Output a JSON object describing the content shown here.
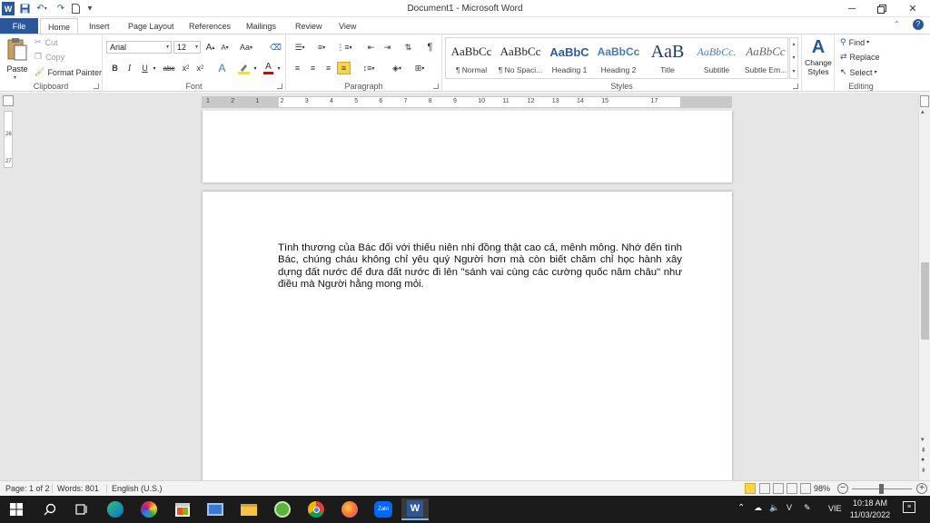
{
  "window": {
    "title": "Document1 - Microsoft Word"
  },
  "tabs": [
    "File",
    "Home",
    "Insert",
    "Page Layout",
    "References",
    "Mailings",
    "Review",
    "View"
  ],
  "clipboard": {
    "paste": "Paste",
    "cut": "Cut",
    "copy": "Copy",
    "format_painter": "Format Painter",
    "label": "Clipboard"
  },
  "font": {
    "name": "Arial",
    "size": "12",
    "label": "Font"
  },
  "paragraph": {
    "label": "Paragraph"
  },
  "styles": {
    "items": [
      {
        "preview": "AaBbCc",
        "name": "¶ Normal"
      },
      {
        "preview": "AaBbCc",
        "name": "¶ No Spaci..."
      },
      {
        "preview": "AaBbC",
        "name": "Heading 1"
      },
      {
        "preview": "AaBbCc",
        "name": "Heading 2"
      },
      {
        "preview": "AaB",
        "name": "Title"
      },
      {
        "preview": "AaBbCc.",
        "name": "Subtitle"
      },
      {
        "preview": "AaBbCc",
        "name": "Subtle Em..."
      }
    ],
    "change_styles": "Change Styles",
    "label": "Styles"
  },
  "editing": {
    "find": "Find",
    "replace": "Replace",
    "select": "Select",
    "label": "Editing"
  },
  "ruler": {
    "ticks": [
      "1",
      "2",
      "1",
      "2",
      "3",
      "4",
      "5",
      "6",
      "7",
      "8",
      "9",
      "10",
      "11",
      "12",
      "13",
      "14",
      "15",
      "",
      "17"
    ],
    "vticks": [
      "26",
      "27"
    ]
  },
  "document": {
    "text": "Tình thương của Bác đối với thiếu niên nhi đồng thật cao cả, mênh mông. Nhớ đến tình Bác, chúng cháu không chỉ yêu quý Người hơn mà còn biết chăm chỉ học hành xây dựng đất nước để đưa đất nước đi lên \"sánh vai cùng các cường quốc năm châu\" như điều mà Người hằng mong mỏi."
  },
  "status": {
    "page": "Page: 1 of 2",
    "words": "Words: 801",
    "language": "English (U.S.)",
    "zoom": "98%",
    "zoom_value": 98
  },
  "taskbar": {
    "time": "10:18 AM",
    "date": "11/03/2022",
    "lang": "VIE"
  },
  "colors": {
    "word_blue": "#2b579a",
    "highlight": "#ffe400",
    "font_red": "#e00000",
    "taskbar": "#1b1b1b"
  }
}
